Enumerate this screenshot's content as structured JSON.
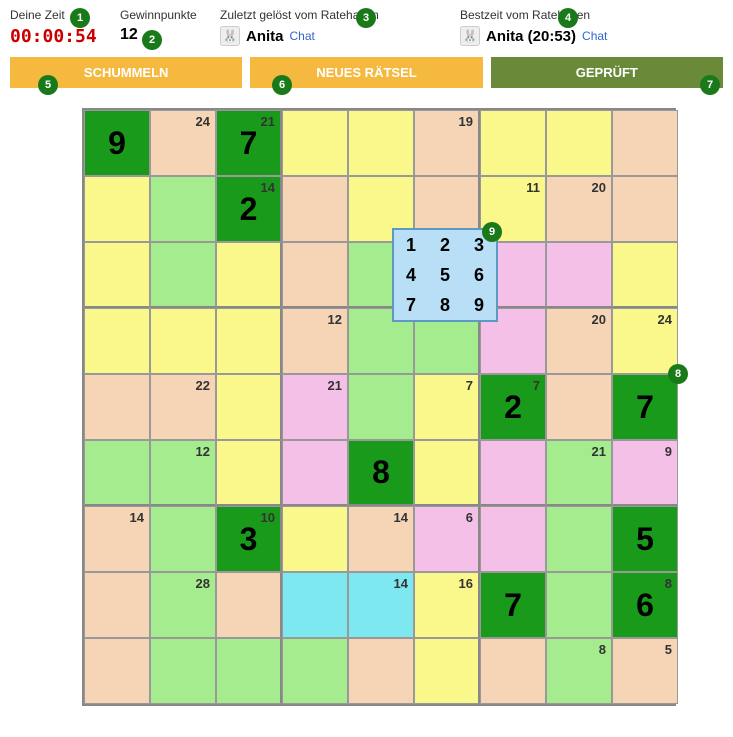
{
  "header": {
    "time_label": "Deine Zeit",
    "time_value": "00:00:54",
    "points_label": "Gewinnpunkte",
    "points_value": "12",
    "last_label": "Zuletzt gelöst vom Ratehasen",
    "last_user": "Anita",
    "best_label": "Bestzeit vom Ratehasen",
    "best_user": "Anita (20:53)",
    "chat": "Chat"
  },
  "buttons": {
    "cheat": "SCHUMMELN",
    "new": "NEUES RÄTSEL",
    "checked": "GEPRÜFT"
  },
  "markers": [
    "1",
    "2",
    "3",
    "4",
    "5",
    "6",
    "7",
    "8",
    "9"
  ],
  "picker": [
    "1",
    "2",
    "3",
    "4",
    "5",
    "6",
    "7",
    "8",
    "9"
  ],
  "cells": [
    {
      "r": 0,
      "c": 0,
      "color": "dgreen",
      "val": "9"
    },
    {
      "r": 0,
      "c": 1,
      "color": "peach",
      "sum": "24"
    },
    {
      "r": 0,
      "c": 2,
      "color": "dgreen",
      "val": "7",
      "sum": "21"
    },
    {
      "r": 0,
      "c": 3,
      "color": "yellow"
    },
    {
      "r": 0,
      "c": 4,
      "color": "yellow"
    },
    {
      "r": 0,
      "c": 5,
      "color": "peach",
      "sum": "19"
    },
    {
      "r": 0,
      "c": 6,
      "color": "yellow"
    },
    {
      "r": 0,
      "c": 7,
      "color": "yellow"
    },
    {
      "r": 0,
      "c": 8,
      "color": "peach"
    },
    {
      "r": 1,
      "c": 0,
      "color": "yellow"
    },
    {
      "r": 1,
      "c": 1,
      "color": "lgreen"
    },
    {
      "r": 1,
      "c": 2,
      "color": "dgreen",
      "val": "2",
      "sum": "14"
    },
    {
      "r": 1,
      "c": 3,
      "color": "peach"
    },
    {
      "r": 1,
      "c": 4,
      "color": "yellow"
    },
    {
      "r": 1,
      "c": 5,
      "color": "peach"
    },
    {
      "r": 1,
      "c": 6,
      "color": "yellow",
      "sum": "11"
    },
    {
      "r": 1,
      "c": 7,
      "color": "peach",
      "sum": "20"
    },
    {
      "r": 1,
      "c": 8,
      "color": "peach"
    },
    {
      "r": 2,
      "c": 0,
      "color": "yellow"
    },
    {
      "r": 2,
      "c": 1,
      "color": "lgreen"
    },
    {
      "r": 2,
      "c": 2,
      "color": "yellow"
    },
    {
      "r": 2,
      "c": 3,
      "color": "peach"
    },
    {
      "r": 2,
      "c": 4,
      "color": "lgreen"
    },
    {
      "r": 2,
      "c": 5,
      "color": "lgreen"
    },
    {
      "r": 2,
      "c": 6,
      "color": "pink"
    },
    {
      "r": 2,
      "c": 7,
      "color": "pink"
    },
    {
      "r": 2,
      "c": 8,
      "color": "yellow"
    },
    {
      "r": 3,
      "c": 0,
      "color": "yellow"
    },
    {
      "r": 3,
      "c": 1,
      "color": "yellow"
    },
    {
      "r": 3,
      "c": 2,
      "color": "yellow"
    },
    {
      "r": 3,
      "c": 3,
      "color": "peach",
      "sum": "12"
    },
    {
      "r": 3,
      "c": 4,
      "color": "lgreen"
    },
    {
      "r": 3,
      "c": 5,
      "color": "lgreen"
    },
    {
      "r": 3,
      "c": 6,
      "color": "pink"
    },
    {
      "r": 3,
      "c": 7,
      "color": "peach",
      "sum": "20"
    },
    {
      "r": 3,
      "c": 8,
      "color": "yellow",
      "sum": "24"
    },
    {
      "r": 4,
      "c": 0,
      "color": "peach"
    },
    {
      "r": 4,
      "c": 1,
      "color": "peach",
      "sum": "22"
    },
    {
      "r": 4,
      "c": 2,
      "color": "yellow"
    },
    {
      "r": 4,
      "c": 3,
      "color": "pink",
      "sum": "21"
    },
    {
      "r": 4,
      "c": 4,
      "color": "lgreen"
    },
    {
      "r": 4,
      "c": 5,
      "color": "yellow",
      "sum": "7"
    },
    {
      "r": 4,
      "c": 6,
      "color": "dgreen",
      "val": "2",
      "sum": "7"
    },
    {
      "r": 4,
      "c": 7,
      "color": "peach"
    },
    {
      "r": 4,
      "c": 8,
      "color": "dgreen",
      "val": "7"
    },
    {
      "r": 5,
      "c": 0,
      "color": "lgreen"
    },
    {
      "r": 5,
      "c": 1,
      "color": "lgreen",
      "sum": "12"
    },
    {
      "r": 5,
      "c": 2,
      "color": "yellow"
    },
    {
      "r": 5,
      "c": 3,
      "color": "pink"
    },
    {
      "r": 5,
      "c": 4,
      "color": "dgreen",
      "val": "8"
    },
    {
      "r": 5,
      "c": 5,
      "color": "yellow"
    },
    {
      "r": 5,
      "c": 6,
      "color": "pink"
    },
    {
      "r": 5,
      "c": 7,
      "color": "lgreen",
      "sum": "21"
    },
    {
      "r": 5,
      "c": 8,
      "color": "pink",
      "sum": "9"
    },
    {
      "r": 6,
      "c": 0,
      "color": "peach",
      "sum": "14"
    },
    {
      "r": 6,
      "c": 1,
      "color": "lgreen"
    },
    {
      "r": 6,
      "c": 2,
      "color": "dgreen",
      "val": "3",
      "sum": "10"
    },
    {
      "r": 6,
      "c": 3,
      "color": "yellow"
    },
    {
      "r": 6,
      "c": 4,
      "color": "peach",
      "sum": "14"
    },
    {
      "r": 6,
      "c": 5,
      "color": "pink",
      "sum": "6"
    },
    {
      "r": 6,
      "c": 6,
      "color": "pink"
    },
    {
      "r": 6,
      "c": 7,
      "color": "lgreen"
    },
    {
      "r": 6,
      "c": 8,
      "color": "dgreen",
      "val": "5"
    },
    {
      "r": 7,
      "c": 0,
      "color": "peach"
    },
    {
      "r": 7,
      "c": 1,
      "color": "lgreen",
      "sum": "28"
    },
    {
      "r": 7,
      "c": 2,
      "color": "peach"
    },
    {
      "r": 7,
      "c": 3,
      "color": "cyan"
    },
    {
      "r": 7,
      "c": 4,
      "color": "cyan",
      "sum": "14"
    },
    {
      "r": 7,
      "c": 5,
      "color": "yellow",
      "sum": "16"
    },
    {
      "r": 7,
      "c": 6,
      "color": "dgreen",
      "val": "7"
    },
    {
      "r": 7,
      "c": 7,
      "color": "lgreen"
    },
    {
      "r": 7,
      "c": 8,
      "color": "dgreen",
      "val": "6",
      "sum": "8"
    },
    {
      "r": 8,
      "c": 0,
      "color": "peach"
    },
    {
      "r": 8,
      "c": 1,
      "color": "lgreen"
    },
    {
      "r": 8,
      "c": 2,
      "color": "lgreen"
    },
    {
      "r": 8,
      "c": 3,
      "color": "lgreen"
    },
    {
      "r": 8,
      "c": 4,
      "color": "peach"
    },
    {
      "r": 8,
      "c": 5,
      "color": "yellow"
    },
    {
      "r": 8,
      "c": 6,
      "color": "peach"
    },
    {
      "r": 8,
      "c": 7,
      "color": "lgreen",
      "sum": "8"
    },
    {
      "r": 8,
      "c": 8,
      "color": "peach",
      "sum": "5"
    }
  ]
}
